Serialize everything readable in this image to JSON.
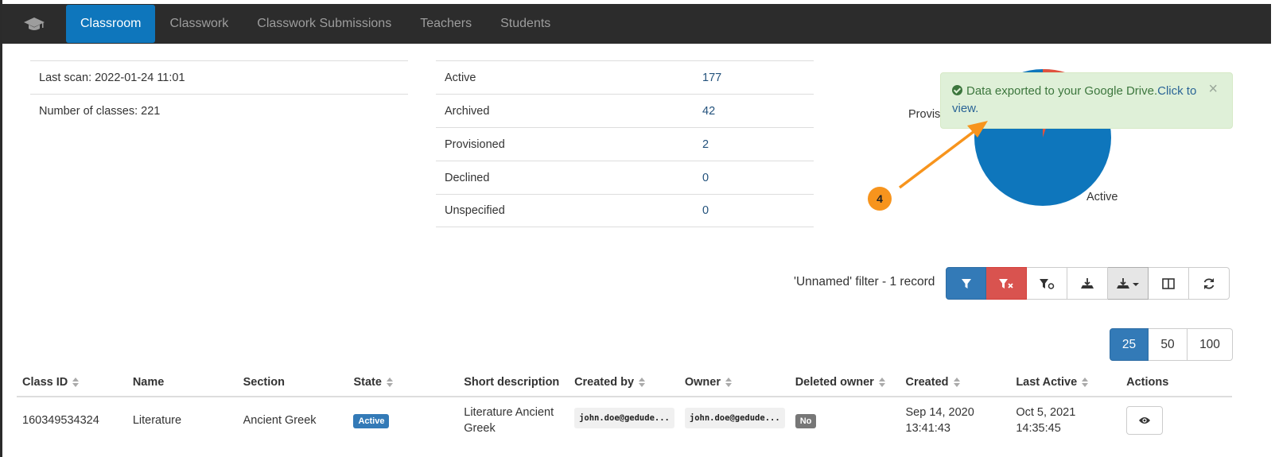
{
  "nav": {
    "items": [
      {
        "label": "Classroom",
        "active": true
      },
      {
        "label": "Classwork",
        "active": false
      },
      {
        "label": "Classwork Submissions",
        "active": false
      },
      {
        "label": "Teachers",
        "active": false
      },
      {
        "label": "Students",
        "active": false
      }
    ]
  },
  "summary": {
    "last_scan": "Last scan: 2022-01-24 11:01",
    "num_classes": "Number of classes: 221"
  },
  "state_counts": [
    {
      "label": "Active",
      "value": "177"
    },
    {
      "label": "Archived",
      "value": "42"
    },
    {
      "label": "Provisioned",
      "value": "2"
    },
    {
      "label": "Declined",
      "value": "0"
    },
    {
      "label": "Unspecified",
      "value": "0"
    }
  ],
  "pie": {
    "label_active": "Active",
    "label_provisioned": "Provis",
    "colors": {
      "active": "#0e76bc",
      "archived": "#e0523f",
      "provisioned": "#f0a030"
    }
  },
  "alert": {
    "text": "Data exported to your Google Drive.",
    "link": "Click to view.",
    "close": "×"
  },
  "annotation": {
    "number": "4"
  },
  "filter": {
    "text": "'Unnamed' filter -  1 record"
  },
  "toolbar": {
    "buttons": [
      "filter-icon",
      "clear-filter-icon",
      "filter-settings-icon",
      "export-icon",
      "export-dropdown-icon",
      "columns-icon",
      "refresh-icon"
    ]
  },
  "page_sizes": [
    "25",
    "50",
    "100"
  ],
  "table": {
    "headers": [
      "Class ID",
      "Name",
      "Section",
      "State",
      "Short description",
      "Created by",
      "Owner",
      "Deleted owner",
      "Created",
      "Last Active",
      "Actions"
    ],
    "rows": [
      {
        "class_id": "160349534324",
        "name": "Literature",
        "section": "Ancient Greek",
        "state": "Active",
        "short_description": "Literature Ancient Greek",
        "created_by": "john.doe@gedude...",
        "owner": "john.doe@gedude...",
        "deleted_owner": "No",
        "created": "Sep 14, 2020 13:41:43",
        "last_active": "Oct 5, 2021 14:35:45"
      }
    ]
  }
}
